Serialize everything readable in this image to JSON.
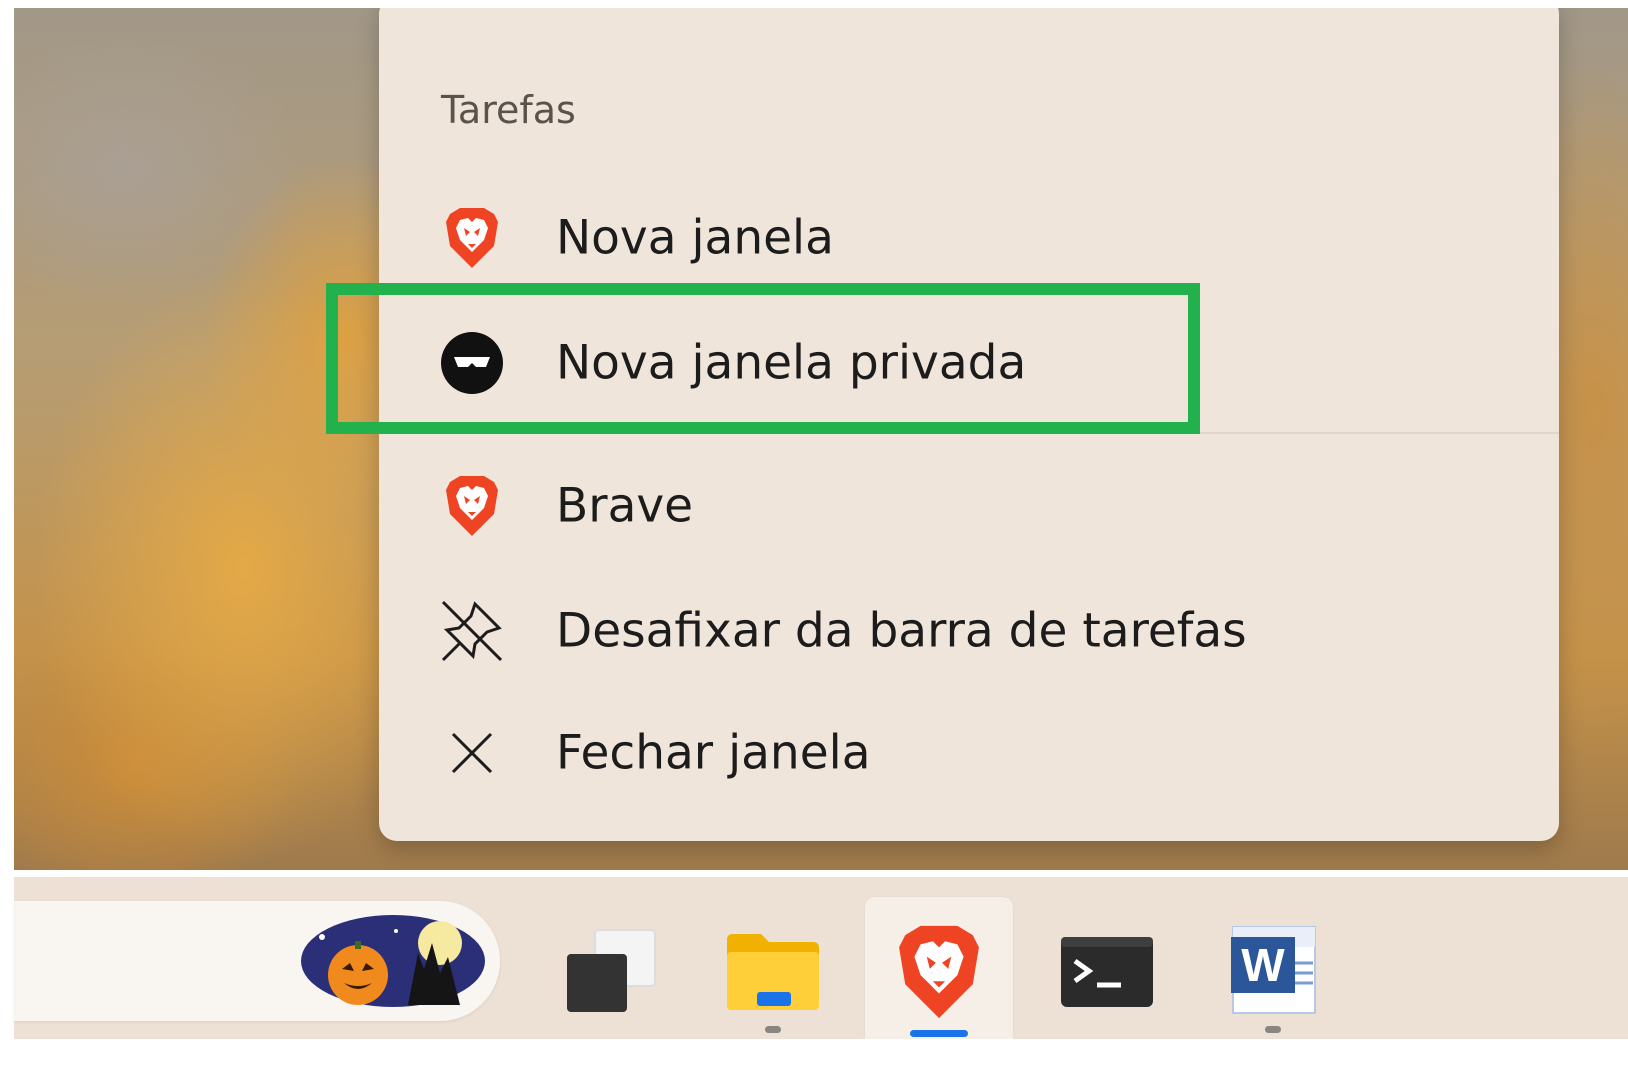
{
  "context_menu": {
    "section_title": "Tarefas",
    "items": [
      {
        "label": "Nova janela",
        "icon": "brave-lion-icon"
      },
      {
        "label": "Nova janela privada",
        "icon": "private-window-icon",
        "highlighted": true
      },
      {
        "label": "Brave",
        "icon": "brave-lion-icon"
      },
      {
        "label": "Desafixar da barra de tarefas",
        "icon": "unpin-icon"
      },
      {
        "label": "Fechar janela",
        "icon": "close-icon"
      }
    ]
  },
  "highlight_color": "#22b14c",
  "taskbar": {
    "apps": [
      {
        "name": "task-view",
        "icon": "task-view-icon",
        "running": false
      },
      {
        "name": "file-explorer",
        "icon": "folder-icon",
        "running": true
      },
      {
        "name": "brave",
        "icon": "brave-lion-icon",
        "running": true,
        "active": true
      },
      {
        "name": "terminal",
        "icon": "terminal-icon",
        "running": false
      },
      {
        "name": "word",
        "icon": "word-icon",
        "running": true
      }
    ],
    "accent_color": "#1a73e8"
  }
}
